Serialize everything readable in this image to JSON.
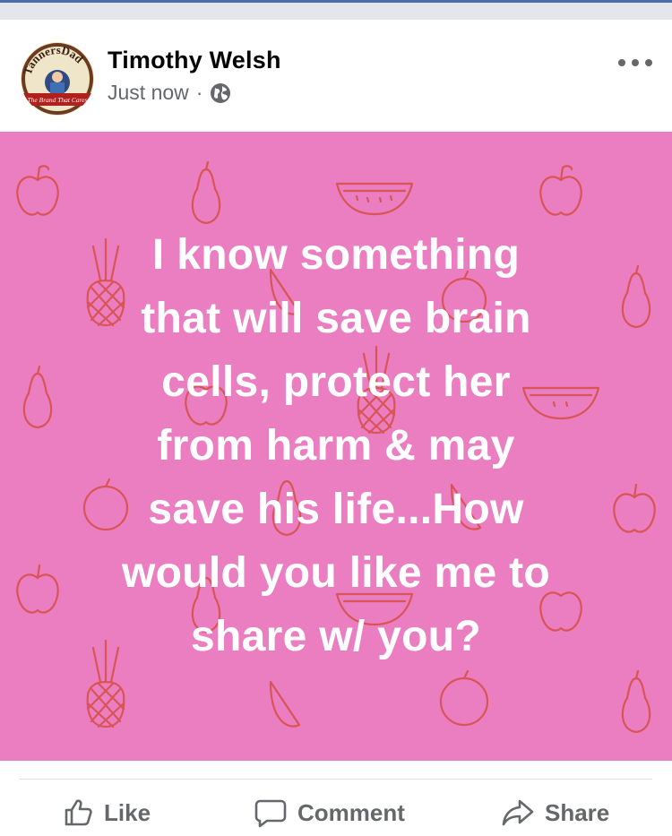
{
  "post": {
    "author": "Timothy Welsh",
    "timestamp": "Just now",
    "separator": "·",
    "privacy_icon": "globe-icon",
    "menu_icon": "more-options-icon",
    "avatar": {
      "text_top": "TannersDad",
      "text_bottom": "The Brand That Cares"
    },
    "text_lines": [
      "I know something",
      "that will save brain",
      "cells, protect her",
      "from harm & may",
      "save his life...How",
      "would you like me to",
      "share w/ you?"
    ],
    "background_color": "#ea7ec1",
    "pattern_color": "#d9534f",
    "pattern_icons": [
      "apple-icon",
      "pear-icon",
      "watermelon-slice-icon",
      "pineapple-icon",
      "orange-icon"
    ]
  },
  "actions": {
    "like": {
      "label": "Like",
      "icon": "thumbs-up-icon"
    },
    "comment": {
      "label": "Comment",
      "icon": "comment-bubble-icon"
    },
    "share": {
      "label": "Share",
      "icon": "share-arrow-icon"
    }
  },
  "colors": {
    "text_primary": "#050505",
    "text_secondary": "#65676b",
    "divider": "#dadde1"
  }
}
